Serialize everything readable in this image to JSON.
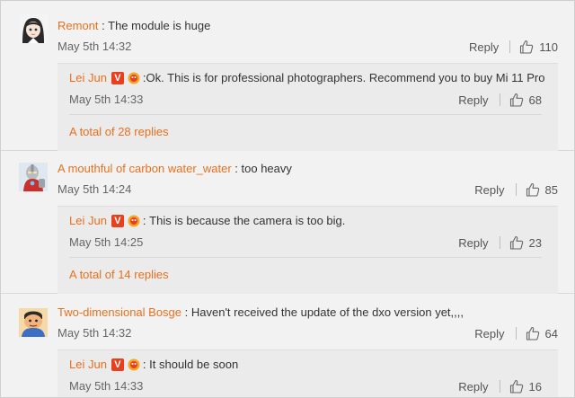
{
  "comments": [
    {
      "user": "Remont",
      "text": "The module is huge",
      "time": "May 5th 14:32",
      "reply_label": "Reply",
      "likes": "110",
      "avatar_icon": "anime-girl-avatar",
      "sub": {
        "user": "Lei Jun",
        "text": "Ok. This is for professional photographers. Recommend you to buy Mi 11 Pro",
        "time": "May 5th 14:33",
        "reply_label": "Reply",
        "likes": "68",
        "total_replies": "A total of 28 replies"
      }
    },
    {
      "user": "A mouthful of carbon water_water",
      "text": "too heavy",
      "time": "May 5th 14:24",
      "reply_label": "Reply",
      "likes": "85",
      "avatar_icon": "ultraman-avatar",
      "sub": {
        "user": "Lei Jun",
        "text": "This is because the camera is too big.",
        "time": "May 5th 14:25",
        "reply_label": "Reply",
        "likes": "23",
        "total_replies": "A total of 14 replies"
      }
    },
    {
      "user": "Two-dimensional Bosge",
      "text": "Haven't received the update of the dxo version yet,,,,",
      "time": "May 5th 14:32",
      "reply_label": "Reply",
      "likes": "64",
      "avatar_icon": "cartoon-man-avatar",
      "sub": {
        "user": "Lei Jun",
        "text": "It should be soon",
        "time": "May 5th 14:33",
        "reply_label": "Reply",
        "likes": "16"
      }
    }
  ],
  "badge_letter": "V",
  "colors": {
    "username": "#e8701e",
    "verified": "#e8401e",
    "background": "#f2f2f2",
    "sub_background": "#ebebeb"
  }
}
